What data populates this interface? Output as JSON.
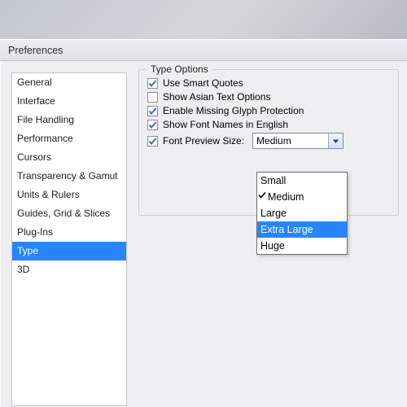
{
  "window": {
    "title": "Preferences"
  },
  "sidebar": {
    "items": [
      {
        "label": "General"
      },
      {
        "label": "Interface"
      },
      {
        "label": "File Handling"
      },
      {
        "label": "Performance"
      },
      {
        "label": "Cursors"
      },
      {
        "label": "Transparency & Gamut"
      },
      {
        "label": "Units & Rulers"
      },
      {
        "label": "Guides, Grid & Slices"
      },
      {
        "label": "Plug-Ins"
      },
      {
        "label": "Type"
      },
      {
        "label": "3D"
      }
    ],
    "selected_index": 9
  },
  "type_options": {
    "legend": "Type Options",
    "checks": [
      {
        "label": "Use Smart Quotes",
        "checked": true
      },
      {
        "label": "Show Asian Text Options",
        "checked": false
      },
      {
        "label": "Enable Missing Glyph Protection",
        "checked": true
      },
      {
        "label": "Show Font Names in English",
        "checked": true
      }
    ],
    "font_preview": {
      "label": "Font Preview Size:",
      "checked": true,
      "selected": "Medium",
      "options": [
        "Small",
        "Medium",
        "Large",
        "Extra Large",
        "Huge"
      ],
      "highlight_index": 3,
      "current_index": 1
    }
  }
}
